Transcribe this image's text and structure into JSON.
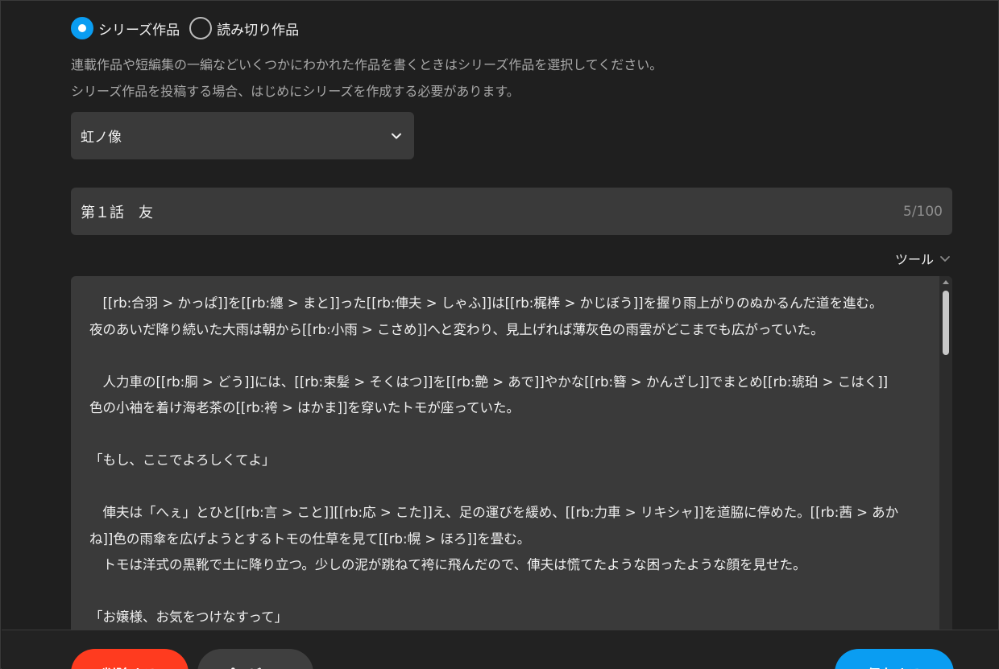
{
  "radio_group": {
    "options": [
      {
        "label": "シリーズ作品",
        "checked": true
      },
      {
        "label": "読み切り作品",
        "checked": false
      }
    ]
  },
  "help": {
    "line1": "連載作品や短編集の一編などいくつかにわかれた作品を書くときはシリーズ作品を選択してください。",
    "line2": "シリーズ作品を投稿する場合、はじめにシリーズを作成する必要があります。"
  },
  "series_select": {
    "value": "虹ノ像",
    "icon": "chevron-down-icon"
  },
  "episode_title": {
    "value": "第１話　友",
    "counter": "5/100"
  },
  "tools": {
    "label": "ツール",
    "icon": "chevron-down-icon"
  },
  "editor": {
    "body": "　[[rb:合羽 > かっぱ]]を[[rb:纏 > まと]]った[[rb:俥夫 > しゃふ]]は[[rb:梶棒 > かじぼう]]を握り雨上がりのぬかるんだ道を進む。\n夜のあいだ降り続いた大雨は朝から[[rb:小雨 > こさめ]]へと変わり、見上げれば薄灰色の雨雲がどこまでも広がっていた。\n\n　人力車の[[rb:胴 > どう]]には、[[rb:束髪 > そくはつ]]を[[rb:艶 > あで]]やかな[[rb:簪 > かんざし]]でまとめ[[rb:琥珀 > こはく]]\n色の小袖を着け海老茶の[[rb:袴 > はかま]]を穿いたトモが座っていた。\n\n「もし、ここでよろしくてよ」\n\n　俥夫は「へぇ」とひと[[rb:言 > こと]][[rb:応 > こた]]え、足の運びを緩め、[[rb:力車 > リキシャ]]を道脇に停めた。[[rb:茜 > あか\nね]]色の雨傘を広げようとするトモの仕草を見て[[rb:幌 > ほろ]]を畳む。\n　トモは洋式の黒靴で土に降り立つ。少しの泥が跳ねて袴に飛んだので、俥夫は慌てたような困ったような顔を見せた。\n\n「お嬢様、お気をつけなすって」"
  },
  "buttons": {
    "delete": "削除する",
    "preview": "プレビュー",
    "save": "保存する"
  },
  "colors": {
    "accent": "#0a9df2",
    "danger": "#ff3b1f",
    "field_bg": "#3a3a3a",
    "page_bg": "#1f1f1f"
  }
}
